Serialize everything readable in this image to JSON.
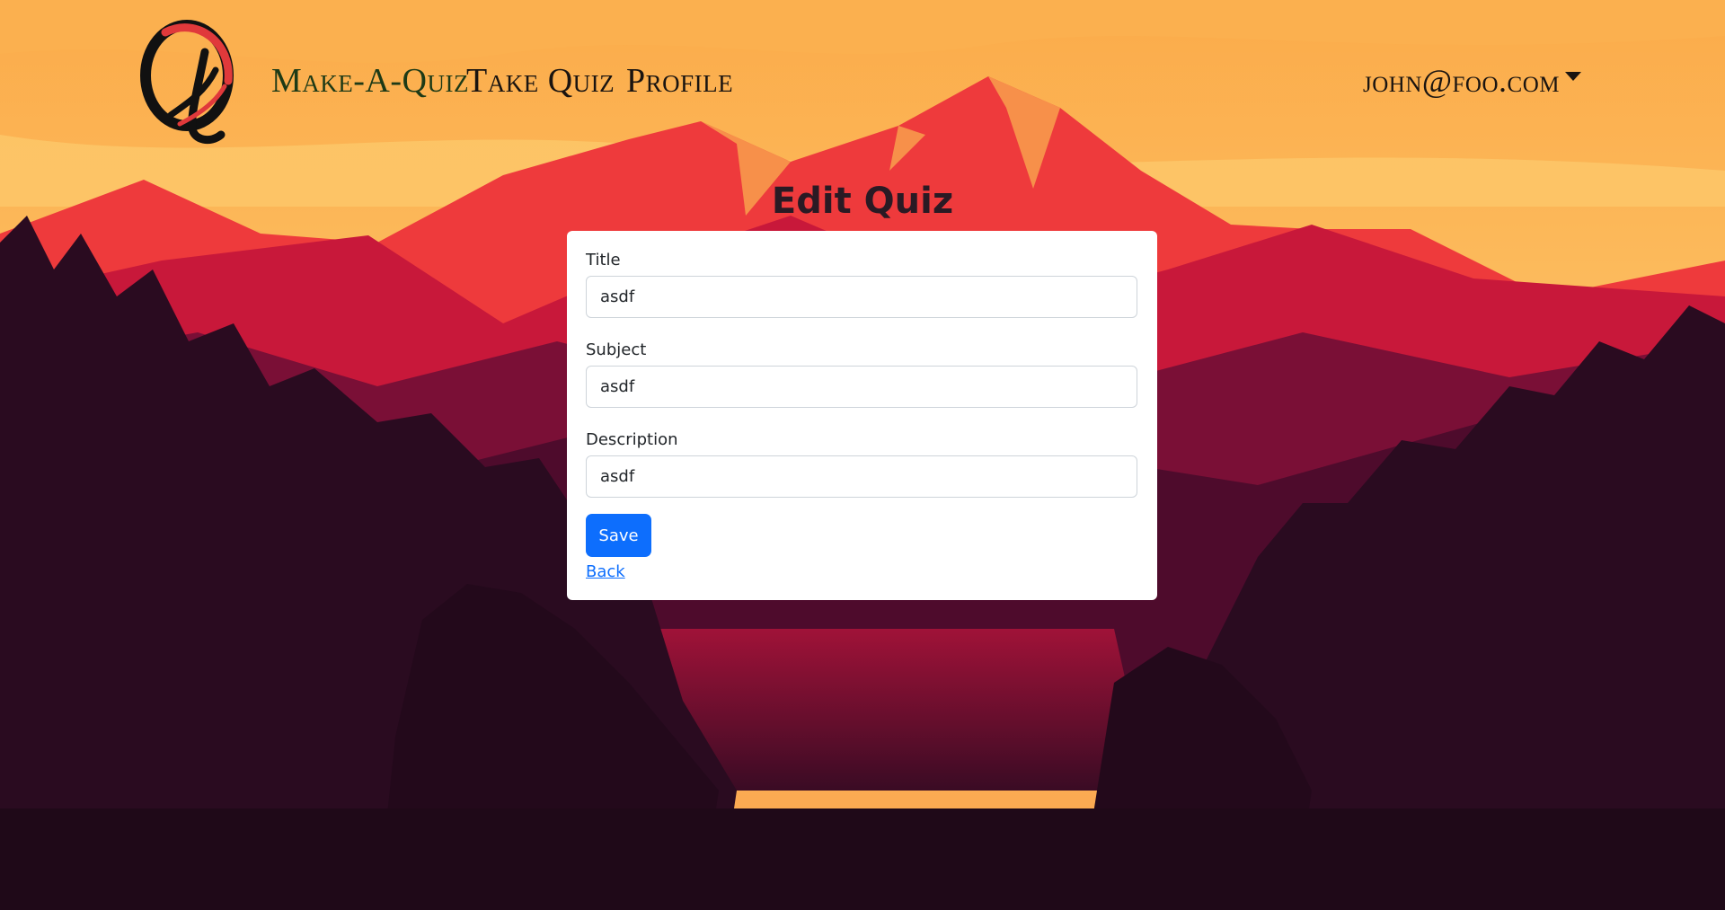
{
  "nav": {
    "brand_label": "Make-A-Quiz",
    "take_quiz_label": "Take Quiz",
    "profile_label": "Profile",
    "user_email": "john@foo.com",
    "user_menu_icon": "caret-down-icon"
  },
  "page": {
    "title": "Edit Quiz"
  },
  "form": {
    "title": {
      "label": "Title",
      "value": "asdf"
    },
    "subject": {
      "label": "Subject",
      "value": "asdf"
    },
    "description": {
      "label": "Description",
      "value": "asdf"
    },
    "save_label": "Save",
    "back_label": "Back"
  },
  "colors": {
    "primary": "#0d6efd",
    "nav_brand": "#1d3a16",
    "sky": "#fcb85c",
    "mountain": "#e8373a",
    "forest": "#2a0d1e"
  }
}
